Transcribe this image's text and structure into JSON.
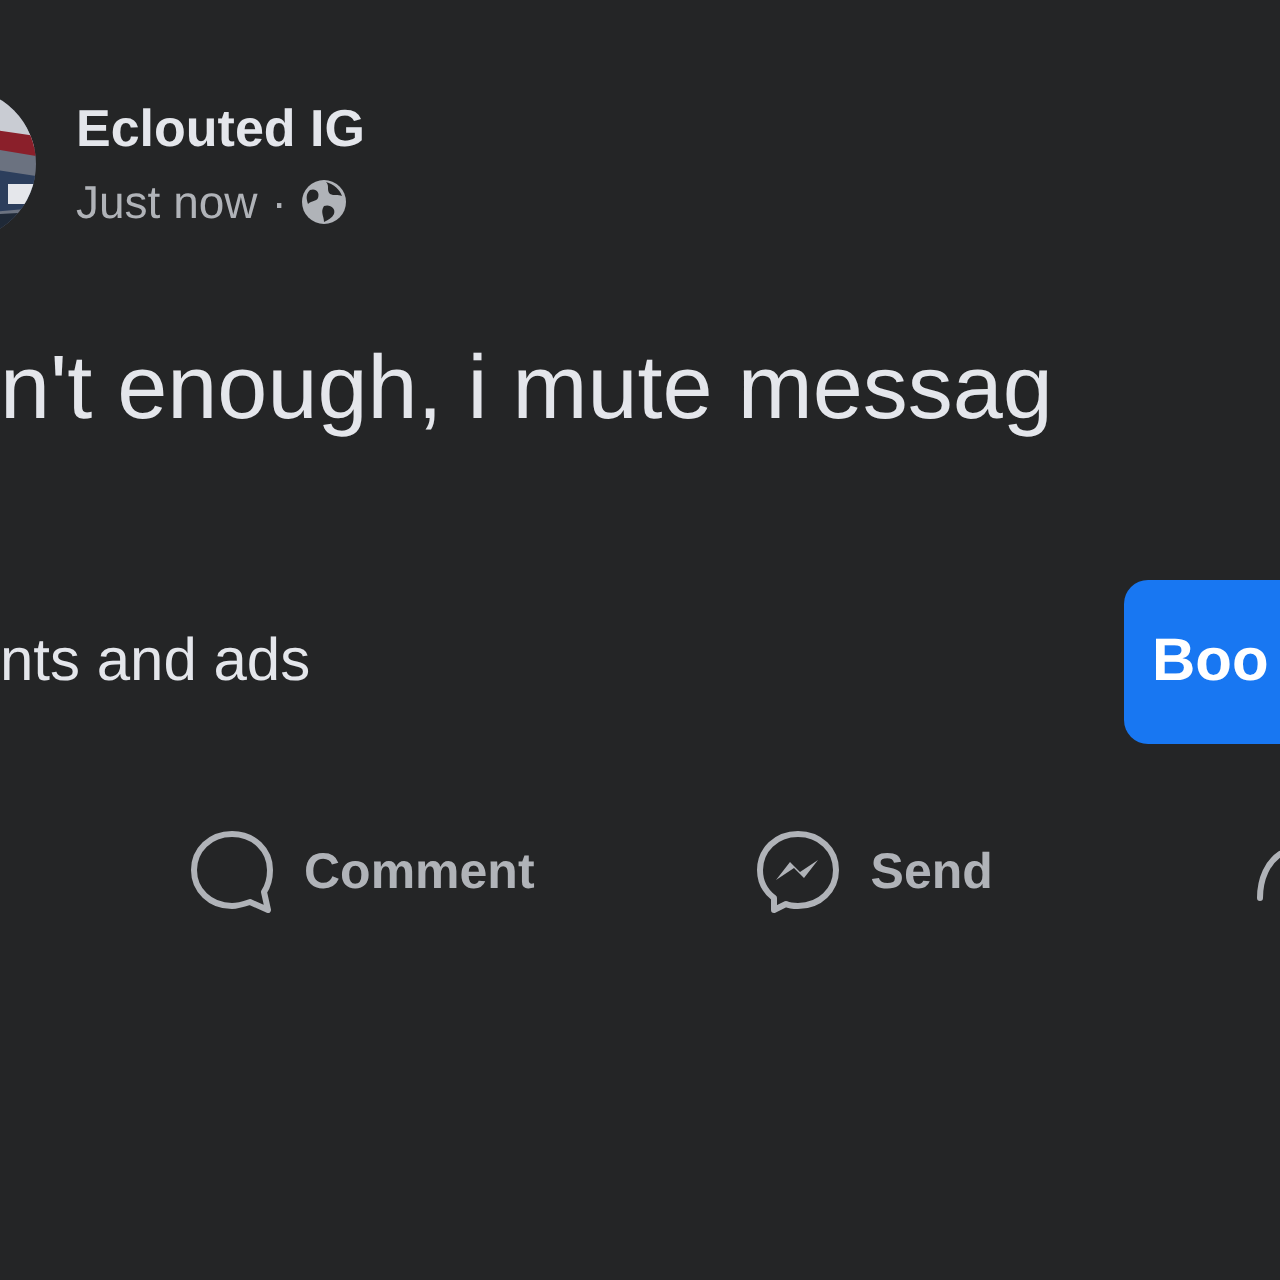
{
  "post": {
    "author": "Eclouted IG",
    "time": "Just now",
    "separator": "·",
    "text": "n't enough, i mute messag"
  },
  "link_preview": {
    "caption": "nts and ads",
    "button": "Boo"
  },
  "actions": [
    {
      "kind": "comment",
      "label": "Comment"
    },
    {
      "kind": "send",
      "label": "Send"
    },
    {
      "kind": "share"
    }
  ]
}
